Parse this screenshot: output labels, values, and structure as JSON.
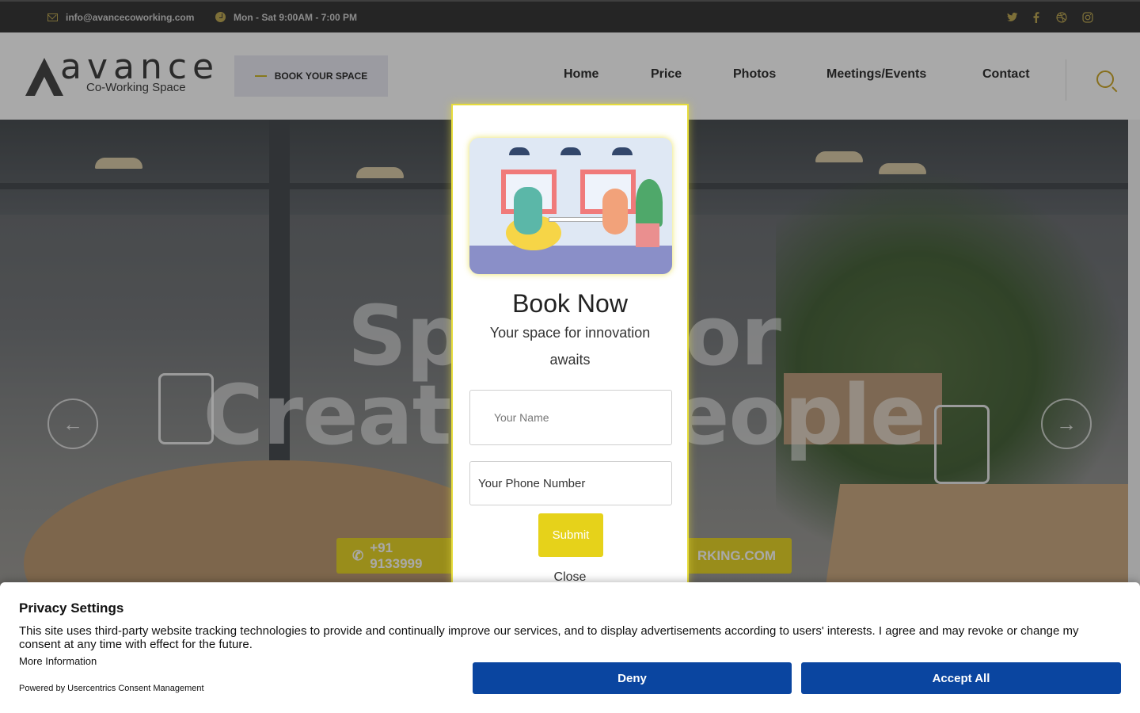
{
  "topbar": {
    "email": "info@avancecoworking.com",
    "hours": "Mon - Sat 9:00AM - 7:00 PM",
    "social": [
      "twitter-icon",
      "facebook-icon",
      "dribbble-icon",
      "instagram-icon"
    ]
  },
  "header": {
    "logo_word": "avance",
    "logo_sub": "Co-Working Space",
    "book_space": "BOOK YOUR SPACE",
    "nav": [
      "Home",
      "Price",
      "Photos",
      "Meetings/Events",
      "Contact"
    ]
  },
  "hero": {
    "title_line1": "Space for",
    "title_line2": "Creative People",
    "cta_phone": "+91 9133999",
    "cta_email": "RKING.COM"
  },
  "modal": {
    "title": "Book Now",
    "subtitle": "Your space for innovation awaits",
    "name_placeholder": "Your Name",
    "phone_placeholder": "Your Phone Number",
    "submit": "Submit",
    "close": "Close"
  },
  "privacy": {
    "title": "Privacy Settings",
    "description": "This site uses third-party website tracking technologies to provide and continually improve our services, and to display advertisements according to users' interests. I agree and may revoke or change my consent at any time with effect for the future.",
    "more_info": "More Information",
    "powered_by": "Powered by Usercentrics Consent Management",
    "deny": "Deny",
    "accept": "Accept All"
  },
  "colors": {
    "accent_yellow": "#e6d21a",
    "consent_blue": "#0a45a0",
    "topbar_bg": "#2a2a2a"
  }
}
